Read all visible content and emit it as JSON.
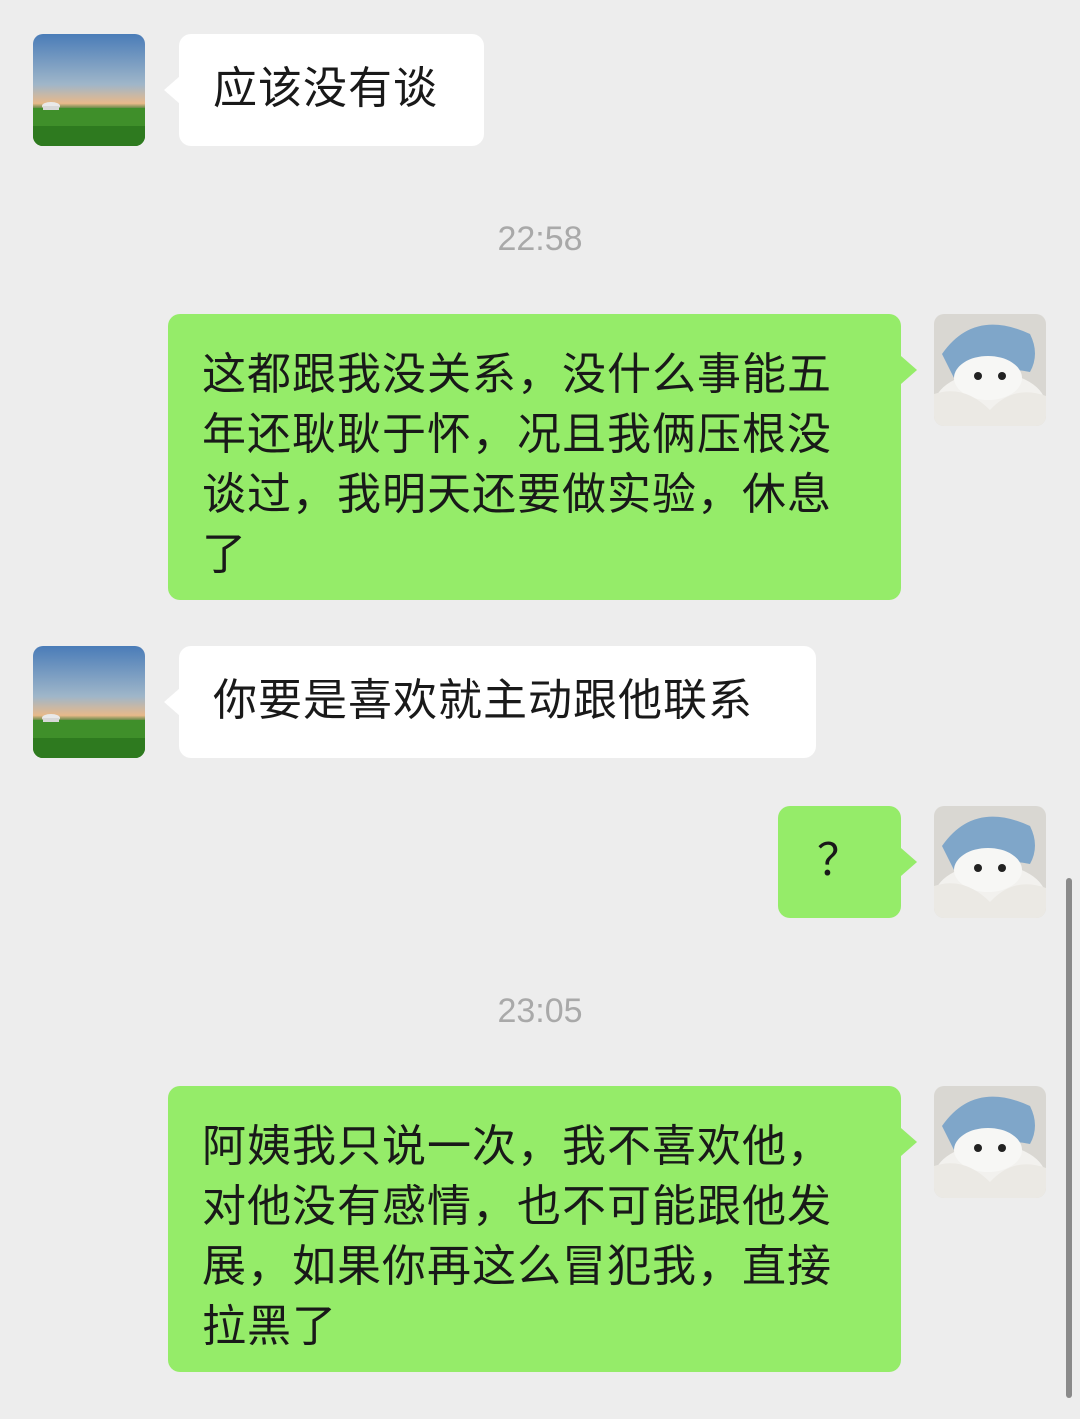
{
  "messages": [
    {
      "sender": "other",
      "text": "应该没有谈"
    },
    {
      "type": "timestamp",
      "text": "22:58"
    },
    {
      "sender": "self",
      "text": "这都跟我没关系，没什么事能五年还耿耿于怀，况且我俩压根没谈过，我明天还要做实验，休息了"
    },
    {
      "sender": "other",
      "text": "你要是喜欢就主动跟他联系"
    },
    {
      "sender": "self",
      "text": "？"
    },
    {
      "type": "timestamp",
      "text": "23:05"
    },
    {
      "sender": "self",
      "text": "阿姨我只说一次，我不喜欢他，对他没有感情，也不可能跟他发展，如果你再这么冒犯我，直接拉黑了"
    }
  ],
  "colors": {
    "background": "#ededed",
    "other_bubble": "#ffffff",
    "self_bubble": "#95ec69",
    "text": "#191919",
    "timestamp": "#a9a9a9"
  },
  "icons": {
    "other_avatar": "grassland-landscape-avatar",
    "self_avatar": "shark-plush-avatar"
  }
}
